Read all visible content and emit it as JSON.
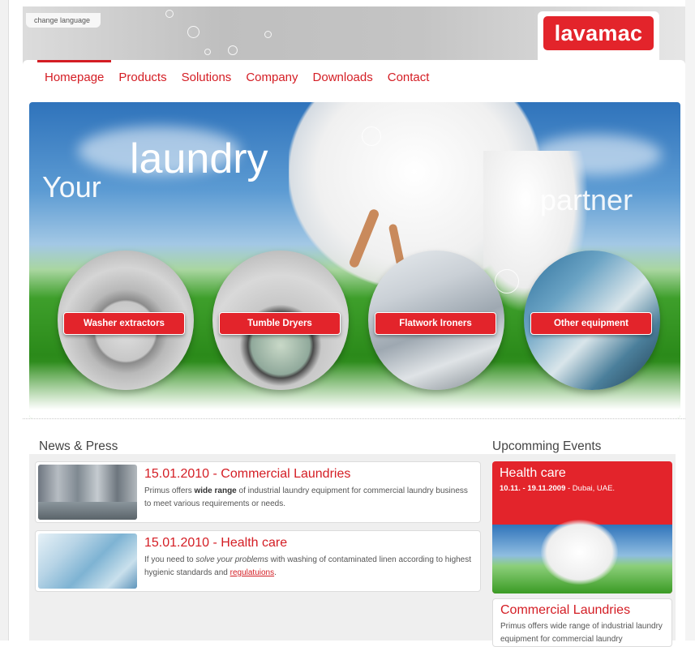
{
  "header": {
    "change_language": "change language",
    "logo": "lavamac"
  },
  "nav": {
    "items": [
      "Homepage",
      "Products",
      "Solutions",
      "Company",
      "Downloads",
      "Contact"
    ],
    "active": "Homepage"
  },
  "hero": {
    "words": [
      "Your",
      "laundry",
      "partner"
    ],
    "categories": [
      "Washer extractors",
      "Tumble Dryers",
      "Flatwork Ironers",
      "Other equipment"
    ]
  },
  "news": {
    "title": "News & Press",
    "items": [
      {
        "headline": "15.01.2010 - Commercial Laundries",
        "text_before": "Primus offers ",
        "text_bold": "wide range",
        "text_after": " of industrial laundry equipment for commercial laundry business to meet various requirements or needs."
      },
      {
        "headline": "15.01.2010 - Health care",
        "text_before": "If you need to ",
        "text_italic": "solve your problems",
        "text_middle": " with washing of contaminated linen according to highest hygienic standards and ",
        "text_link": "regulatuions",
        "text_after": "."
      }
    ]
  },
  "events": {
    "title": "Upcomming Events",
    "featured": {
      "title": "Health care",
      "date": "10.11. - 19.11.2009",
      "location": " - Dubai, UAE."
    },
    "second": {
      "title": "Commercial Laundries",
      "text": "Primus offers wide range of industrial laundry equipment for commercial laundry"
    }
  },
  "colors": {
    "brand_red": "#e3242b",
    "nav_red": "#d41d24"
  }
}
